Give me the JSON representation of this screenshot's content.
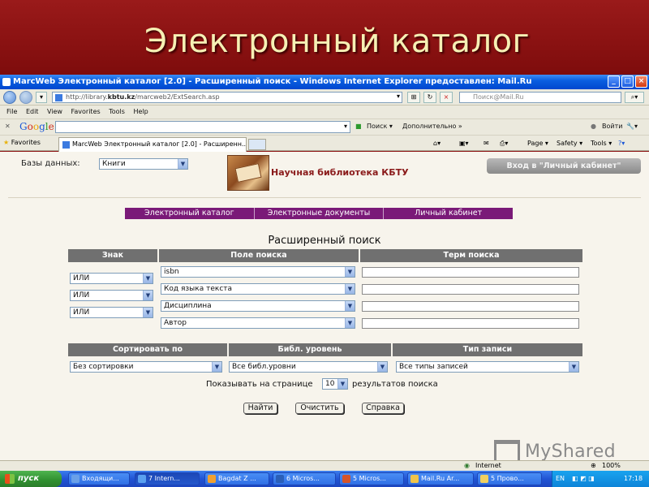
{
  "slide": {
    "title": "Электронный каталог"
  },
  "window": {
    "title": "MarcWeb Электронный каталог [2.0] - Расширенный поиск - Windows Internet Explorer предоставлен: Mail.Ru",
    "btn_min": "_",
    "btn_max": "□",
    "btn_close": "×"
  },
  "address": {
    "url_prefix": "http://library.",
    "url_host": "kbtu.kz",
    "url_path": "/marcweb2/ExtSearch.asp",
    "search_placeholder": "Поиск@Mail.Ru"
  },
  "menu": [
    "File",
    "Edit",
    "View",
    "Favorites",
    "Tools",
    "Help"
  ],
  "google_bar": {
    "logo": [
      "G",
      "o",
      "o",
      "g",
      "l",
      "e"
    ],
    "search_label": "Поиск ▾",
    "more_label": "Дополнительно »",
    "login_label": "Войти"
  },
  "tabs_bar": {
    "favorites_label": "Favorites",
    "tab_title": "MarcWeb Электронный каталог [2.0] - Расширенн...",
    "page_label": "Page ▾",
    "safety_label": "Safety ▾",
    "tools_label": "Tools ▾",
    "help_label": "?▾"
  },
  "header": {
    "db_label": "Базы данных:",
    "db_value": "Книги",
    "library_name": "Научная библиотека КБТУ",
    "cabinet_button": "Вход в \"Личный кабинет\""
  },
  "nav": [
    "Электронный каталог",
    "Электронные документы",
    "Личный кабинет"
  ],
  "search": {
    "title": "Расширенный поиск",
    "col_sign": "Знак",
    "col_field": "Поле поиска",
    "col_term": "Терм поиска",
    "sign_values": [
      "ИЛИ",
      "ИЛИ",
      "ИЛИ"
    ],
    "field_values": [
      "isbn",
      "Код языка текста",
      "Дисциплина",
      "Автор"
    ]
  },
  "options": {
    "col_sort": "Сортировать по",
    "col_level": "Библ. уровень",
    "col_type": "Тип записи",
    "sort_value": "Без сортировки",
    "level_value": "Все библ.уровни",
    "type_value": "Все типы записей",
    "per_page_before": "Показывать на странице",
    "per_page_value": "10",
    "per_page_after": "результатов поиска"
  },
  "buttons": {
    "find": "Найти",
    "clear": "Очистить",
    "help": "Справка"
  },
  "status": {
    "zone": "Internet",
    "zoom": "100%"
  },
  "watermark": "MyShared",
  "taskbar": {
    "start": "пуск",
    "tasks": [
      "Входящи...",
      "7 Intern...",
      "Bagdat Z ...",
      "6 Micros...",
      "5 Micros...",
      "Mail.Ru Ar...",
      "5 Прово..."
    ],
    "lang": "EN",
    "clock": "17:18"
  }
}
